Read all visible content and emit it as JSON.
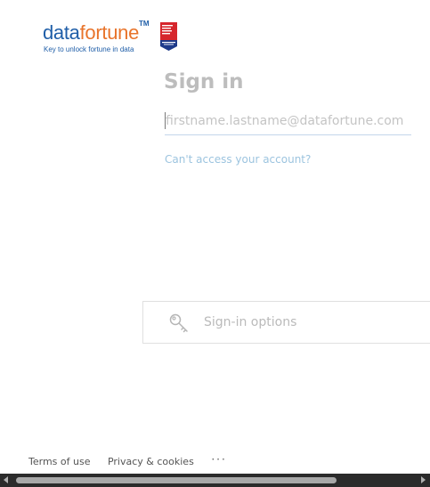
{
  "logo": {
    "word_part1": "data",
    "word_part2": "fortune",
    "trademark": "TM",
    "tagline": "Key to unlock fortune in data",
    "brand_blue": "#1f5ea8",
    "brand_orange": "#e8742b"
  },
  "badge": {
    "icon": "great-place-to-work-badge"
  },
  "signin": {
    "title": "Sign in",
    "email_placeholder": "firstname.lastname@datafortune.com",
    "email_value": "",
    "cant_access_link": "Can't access your account?"
  },
  "options": {
    "label": "Sign-in options",
    "icon": "key-icon"
  },
  "footer": {
    "terms": "Terms of use",
    "privacy": "Privacy & cookies",
    "more": "···"
  },
  "colors": {
    "title_gray": "#bdbdbd",
    "link_blue": "#9cc4df"
  }
}
